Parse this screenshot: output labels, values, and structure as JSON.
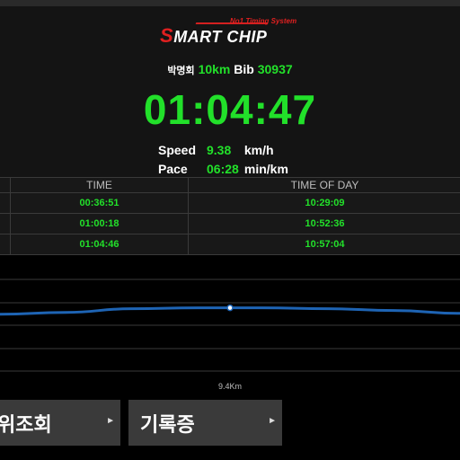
{
  "logo": {
    "tagline": "No1 Timing System",
    "s_letter": "S",
    "rest": "MART CHIP"
  },
  "runner": {
    "name": "박명회",
    "race": "10km",
    "bib_label": "Bib",
    "bib": "30937"
  },
  "finish_time": "01:04:47",
  "speed": {
    "label": "Speed",
    "value": "9.38",
    "unit": "km/h"
  },
  "pace": {
    "label": "Pace",
    "value": "06:28",
    "unit": "min/km"
  },
  "splits": {
    "headers": [
      "",
      "TIME",
      "TIME OF DAY"
    ],
    "rows": [
      {
        "point": "",
        "time": "00:36:51",
        "time_of_day": "10:29:09"
      },
      {
        "point": "",
        "time": "01:00:18",
        "time_of_day": "10:52:36"
      },
      {
        "point": "",
        "time": "01:04:46",
        "time_of_day": "10:57:04"
      }
    ]
  },
  "chart_data": {
    "type": "line",
    "x": [
      "9.4Km"
    ],
    "x_tick_label": "9.4Km",
    "series": [
      {
        "values": [
          0.62,
          0.64,
          0.68,
          0.69,
          0.69,
          0.68,
          0.66,
          0.63
        ]
      }
    ],
    "grid": true,
    "color": "#1e64b4"
  },
  "buttons": {
    "location": "위조회",
    "certificate": "기록증"
  },
  "colors": {
    "accent_green": "#22e02a",
    "brand_red": "#e02020",
    "line_blue": "#1e64b4"
  }
}
